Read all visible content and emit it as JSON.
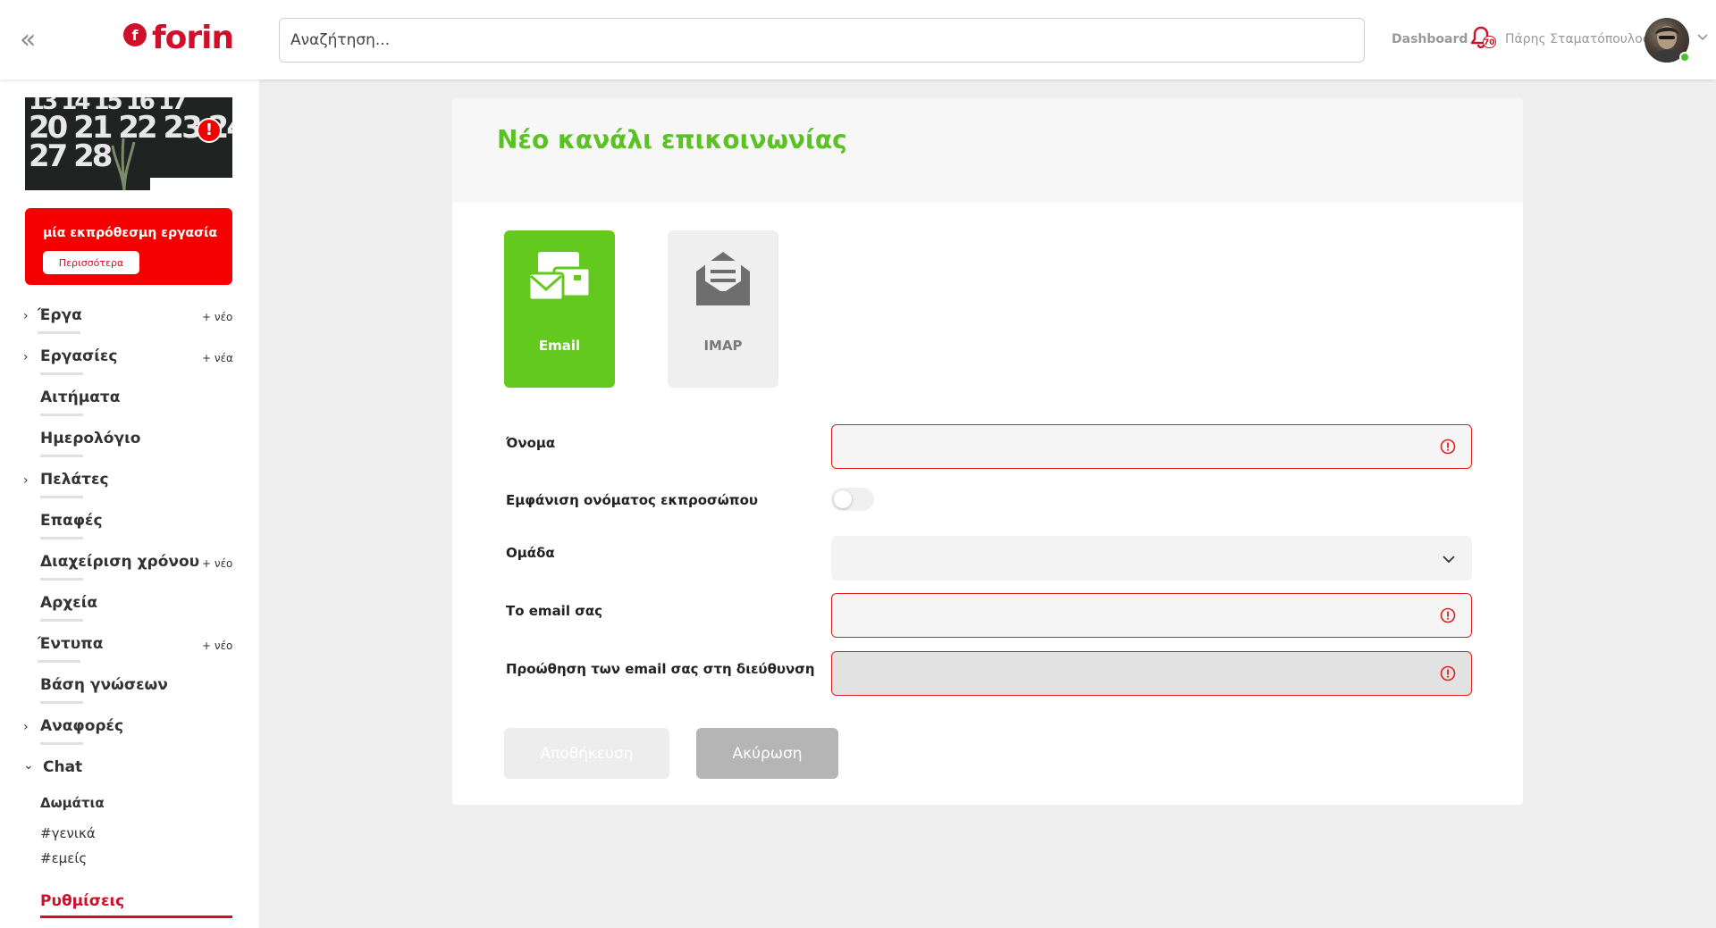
{
  "header": {
    "logo_text": "forin",
    "logo_mark": "f",
    "search_placeholder": "Αναζήτηση...",
    "dashboard_link": "Dashboard",
    "notification_count": "70",
    "user_name": "Πάρης Σταματόπουλος"
  },
  "sidebar": {
    "calendar_rows": [
      "13 14 15 16 17",
      "20 21 22 23 24",
      "27 28"
    ],
    "alert": {
      "text": "μία εκπρόθεσμη εργασία",
      "button": "Περισσότερα",
      "icon": "!"
    },
    "items": [
      {
        "label": "Έργα",
        "chevron": "right",
        "new_label": "+ νέο"
      },
      {
        "label": "Εργασίες",
        "chevron": "right",
        "new_label": "+ νέα"
      },
      {
        "label": "Αιτήματα"
      },
      {
        "label": "Ημερολόγιο"
      },
      {
        "label": "Πελάτες",
        "chevron": "right"
      },
      {
        "label": "Επαφές"
      },
      {
        "label": "Διαχείριση χρόνου",
        "new_label": "+ νέο"
      },
      {
        "label": "Αρχεία"
      },
      {
        "label": "Έντυπα",
        "new_label": "+ νέο"
      },
      {
        "label": "Βάση γνώσεων"
      },
      {
        "label": "Αναφορές",
        "chevron": "right"
      },
      {
        "label": "Chat",
        "chevron": "down"
      }
    ],
    "chat": {
      "rooms_label": "Δωμάτια",
      "rooms": [
        "#γενικά",
        "#εμείς"
      ]
    },
    "settings_label": "Ρυθμίσεις"
  },
  "main": {
    "title": "Νέο κανάλι επικοινωνίας",
    "types": [
      {
        "label": "Email",
        "selected": true
      },
      {
        "label": "IMAP",
        "selected": false
      }
    ],
    "fields": {
      "name_label": "Όνομα",
      "name_value": "",
      "show_agent_label": "Εμφάνιση ονόματος εκπροσώπου",
      "group_label": "Ομάδα",
      "group_value": "",
      "email_label": "Το email σας",
      "email_value": "",
      "forward_label": "Προώθηση των email σας στη διεύθυνση",
      "forward_value": ""
    },
    "buttons": {
      "save": "Αποθήκευση",
      "cancel": "Ακύρωση"
    }
  },
  "colors": {
    "brand": "#d0102a",
    "accent_green": "#5bc224",
    "error": "#e02020"
  }
}
